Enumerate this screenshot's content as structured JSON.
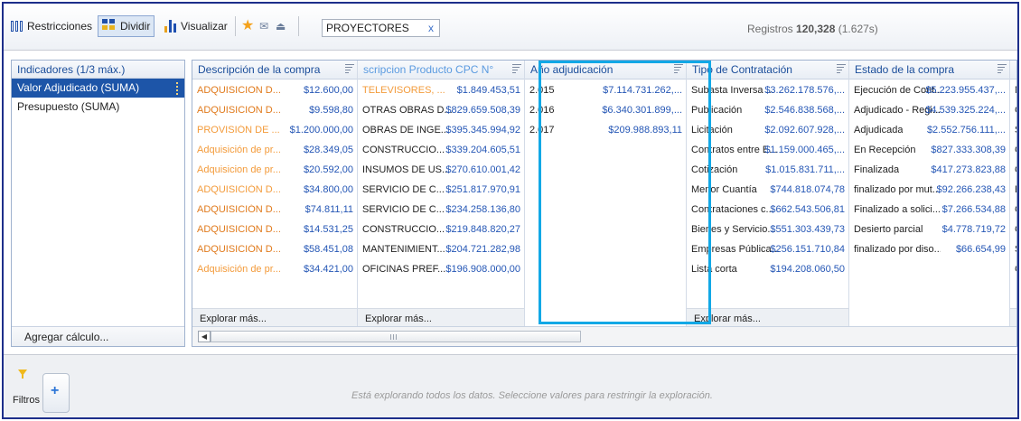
{
  "toolbar": {
    "restrictions_label": "Restricciones",
    "split_label": "Dividir",
    "visualize_label": "Visualizar",
    "search_value": "PROYECTORES",
    "search_clear": "x",
    "records_label": "Registros",
    "records_count": "120,328",
    "records_time": "(1.627s)"
  },
  "indicators": {
    "title": "Indicadores (1/3 máx.)",
    "items": [
      "Valor Adjudicado (SUMA)",
      "Presupuesto (SUMA)"
    ],
    "selected_index": 0,
    "add_calc_label": "Agregar cálculo..."
  },
  "columns": [
    {
      "title": "Descripción de la compra",
      "rows": [
        {
          "label": "ADQUISICION D...",
          "value": "$12.600,00"
        },
        {
          "label": "ADQUISICION D...",
          "value": "$9.598,80"
        },
        {
          "label": "PROVISIÓN DE ...",
          "value": "$1.200.000,00"
        },
        {
          "label": "Adquisición de pr...",
          "value": "$28.349,05"
        },
        {
          "label": "Adquisicion de pr...",
          "value": "$20.592,00"
        },
        {
          "label": "ADQUISICIÓN D...",
          "value": "$34.800,00"
        },
        {
          "label": "ADQUISICIÓN D...",
          "value": "$74.811,11"
        },
        {
          "label": "ADQUISICION D...",
          "value": "$14.531,25"
        },
        {
          "label": "ADQUISICIÓN D...",
          "value": "$58.451,08"
        },
        {
          "label": "Adquisición de pr...",
          "value": "$34.421,00"
        }
      ],
      "more": "Explorar más..."
    },
    {
      "title": "scripcion Producto CPC N°",
      "rows": [
        {
          "label": "TELEVISORES, ...",
          "value": "$1.849.453,51"
        },
        {
          "label": "OTRAS OBRAS D...",
          "value": "$829.659.508,39"
        },
        {
          "label": "OBRAS DE INGE...",
          "value": "$395.345.994,92"
        },
        {
          "label": "CONSTRUCCIO...",
          "value": "$339.204.605,51"
        },
        {
          "label": "INSUMOS DE US...",
          "value": "$270.610.001,42"
        },
        {
          "label": "SERVICIO DE C...",
          "value": "$251.817.970,91"
        },
        {
          "label": "SERVICIO DE C...",
          "value": "$234.258.136,80"
        },
        {
          "label": "CONSTRUCCIO...",
          "value": "$219.848.820,27"
        },
        {
          "label": "MANTENIMIENT...",
          "value": "$204.721.282,98"
        },
        {
          "label": "OFICINAS PREF...",
          "value": "$196.908.000,00"
        }
      ],
      "more": "Explorar más..."
    },
    {
      "title": "Año adjudicación",
      "rows": [
        {
          "label": "2.015",
          "value": "$7.114.731.262,..."
        },
        {
          "label": "2.016",
          "value": "$6.340.301.899,..."
        },
        {
          "label": "2.017",
          "value": "$209.988.893,11"
        }
      ],
      "more": ""
    },
    {
      "title": "Tipo de Contratación",
      "rows": [
        {
          "label": "Subasta Inversa ...",
          "value": "$3.262.178.576,..."
        },
        {
          "label": "Publicación",
          "value": "$2.546.838.568,..."
        },
        {
          "label": "Licitación",
          "value": "$2.092.607.928,..."
        },
        {
          "label": "Contratos entre E...",
          "value": "$1.159.000.465,..."
        },
        {
          "label": "Cotización",
          "value": "$1.015.831.711,..."
        },
        {
          "label": "Menor Cuantía",
          "value": "$744.818.074,78"
        },
        {
          "label": "Contrataciones c...",
          "value": "$662.543.506,81"
        },
        {
          "label": "Bienes y Servicio...",
          "value": "$551.303.439,73"
        },
        {
          "label": "Empresas Pública...",
          "value": "$256.151.710,84"
        },
        {
          "label": "Lista corta",
          "value": "$194.208.060,50"
        }
      ],
      "more": "Explorar más..."
    },
    {
      "title": "Estado de la compra",
      "rows": [
        {
          "label": "Ejecución de Cont...",
          "value": "$5.223.955.437,..."
        },
        {
          "label": "Adjudicado - Regi...",
          "value": "$4.539.325.224,..."
        },
        {
          "label": "Adjudicada",
          "value": "$2.552.756.111,..."
        },
        {
          "label": "En Recepción",
          "value": "$827.333.308,39"
        },
        {
          "label": "Finalizada",
          "value": "$417.273.823,88"
        },
        {
          "label": "finalizado por mut...",
          "value": "$92.266.238,43"
        },
        {
          "label": "Finalizado a solici...",
          "value": "$7.266.534,88"
        },
        {
          "label": "Desierto parcial",
          "value": "$4.778.719,72"
        },
        {
          "label": "finalizado por diso...",
          "value": "$66.654,99"
        }
      ],
      "more": ""
    },
    {
      "title": "No",
      "rows": [
        {
          "label": "NC",
          "value": ""
        },
        {
          "label": "CU",
          "value": ""
        },
        {
          "label": "SE",
          "value": ""
        },
        {
          "label": "CU",
          "value": ""
        },
        {
          "label": "QU",
          "value": ""
        },
        {
          "label": "EN",
          "value": ""
        },
        {
          "label": "CU",
          "value": ""
        },
        {
          "label": "CO",
          "value": ""
        },
        {
          "label": "SI",
          "value": ""
        },
        {
          "label": "CO",
          "value": ""
        }
      ],
      "more": "E"
    }
  ],
  "filters": {
    "label": "Filtros",
    "add_symbol": "+",
    "hint": "Está explorando todos los datos. Seleccione valores para restringir la exploración."
  },
  "colors": {
    "accent_blue": "#1d55a8",
    "value_blue": "#2456b5",
    "orange": "#e07a1c",
    "highlight_cyan": "#12a8e6",
    "frame_navy": "#1d2e8a"
  }
}
